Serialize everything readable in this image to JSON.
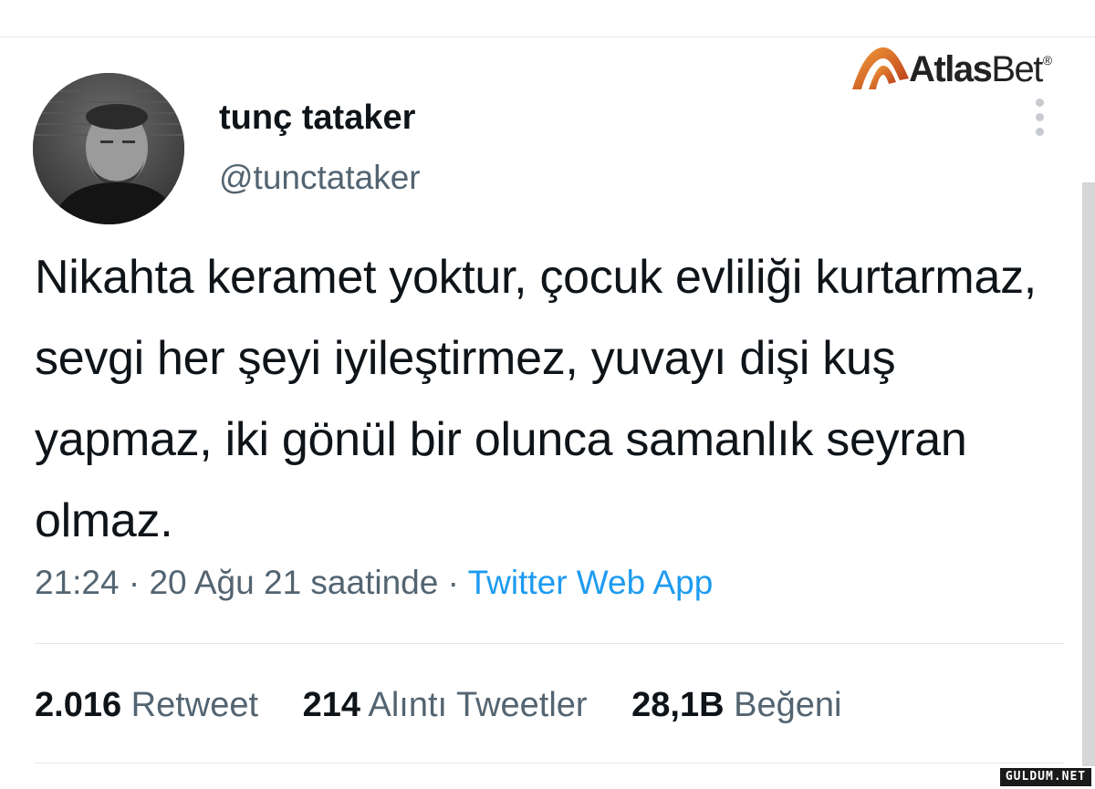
{
  "watermark": {
    "brand_primary": "Atlas",
    "brand_secondary": "Bet",
    "registered_mark": "®",
    "site": "GULDUM.NET"
  },
  "tweet": {
    "display_name": "tunç tataker",
    "handle": "@tunctataker",
    "text": "Nikahta keramet yoktur, çocuk evliliği kurtarmaz, sevgi her şeyi iyileştirmez, yuvayı dişi kuş yapmaz, iki gönül bir olunca samanlık seyran olmaz.",
    "time": "21:24",
    "date_text": "20 Ağu 21 saatinde",
    "separator": "·",
    "source": "Twitter Web App",
    "stats": [
      {
        "value": "2.016",
        "label": "Retweet"
      },
      {
        "value": "214",
        "label": "Alıntı Tweetler"
      },
      {
        "value": "28,1B",
        "label": "Beğeni"
      }
    ]
  },
  "icons": {
    "more": "more-vertical-icon",
    "avatar": "user-avatar"
  },
  "colors": {
    "text_primary": "#0f1419",
    "text_secondary": "#536471",
    "link": "#1d9bf0",
    "divider": "#e3e7ea",
    "brand_accent": "#e8731c"
  }
}
